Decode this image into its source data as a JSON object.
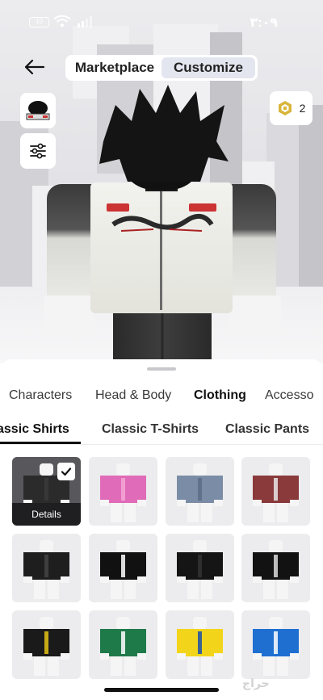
{
  "status_bar": {
    "time": "٣:٠٩",
    "battery": "10"
  },
  "header": {
    "back_icon": "arrow-left-icon",
    "segments": [
      {
        "label": "Marketplace",
        "active": false
      },
      {
        "label": "Customize",
        "active": true
      }
    ]
  },
  "left_tools": {
    "avatar_thumbnail_icon": "avatar-thumbnail-icon",
    "settings_icon": "sliders-icon"
  },
  "currency": {
    "icon": "robux-icon",
    "balance": "2"
  },
  "categories": [
    {
      "label": "Characters",
      "active": false
    },
    {
      "label": "Head & Body",
      "active": false
    },
    {
      "label": "Clothing",
      "active": true
    },
    {
      "label": "Accesso",
      "active": false
    }
  ],
  "subcategories": [
    {
      "label": "assic Shirts",
      "active": true
    },
    {
      "label": "Classic T-Shirts",
      "active": false
    },
    {
      "label": "Classic Pants",
      "active": false
    }
  ],
  "items": [
    {
      "name": "selected-shirt",
      "selected": true,
      "details_label": "Details",
      "color": "#2b2b2b",
      "accent": "#3a3a3a"
    },
    {
      "name": "pink-shirt",
      "selected": false,
      "color": "#e06bb8",
      "accent": "#f4a7d6"
    },
    {
      "name": "blue-gray-shirt",
      "selected": false,
      "color": "#7b8da6",
      "accent": "#5c6d85"
    },
    {
      "name": "plaid-shirt",
      "selected": false,
      "color": "#8a3a3a",
      "accent": "#e8e8e8"
    },
    {
      "name": "black-jacket-1",
      "selected": false,
      "color": "#1e1e1e",
      "accent": "#444"
    },
    {
      "name": "black-suit",
      "selected": false,
      "color": "#111111",
      "accent": "#ffffff"
    },
    {
      "name": "black-jacket-2",
      "selected": false,
      "color": "#151515",
      "accent": "#333"
    },
    {
      "name": "black-shirt-white-collar",
      "selected": false,
      "color": "#121212",
      "accent": "#dcdcdc"
    },
    {
      "name": "black-yellow-jersey",
      "selected": false,
      "color": "#1a1a1a",
      "accent": "#e6c316"
    },
    {
      "name": "green-jersey",
      "selected": false,
      "color": "#1f7a4a",
      "accent": "#ffffff"
    },
    {
      "name": "yellow-jersey",
      "selected": false,
      "color": "#f2d51a",
      "accent": "#1a4ea8"
    },
    {
      "name": "blue-jersey",
      "selected": false,
      "color": "#1f6fd1",
      "accent": "#ffffff"
    }
  ],
  "watermark": "حراج"
}
